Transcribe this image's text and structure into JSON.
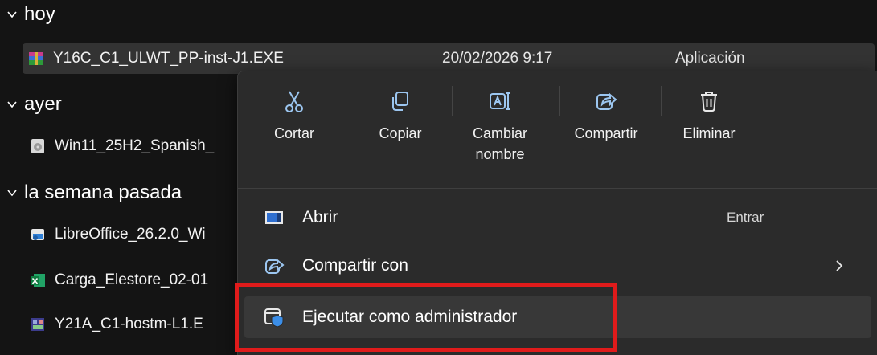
{
  "groups": [
    {
      "label": "hoy"
    },
    {
      "label": "ayer"
    },
    {
      "label": "la semana pasada"
    }
  ],
  "files": [
    {
      "name": "Y16C_C1_ULWT_PP-inst-J1.EXE",
      "date": "20/02/2026 9:17",
      "type": "Aplicación",
      "icon": "winrar-exe-icon"
    },
    {
      "name": "Win11_25H2_Spanish_",
      "icon": "disc-image-icon"
    },
    {
      "name": "LibreOffice_26.2.0_Wi",
      "icon": "installer-package-icon"
    },
    {
      "name": "Carga_Elestore_02-01",
      "icon": "excel-file-icon"
    },
    {
      "name": "Y21A_C1-hostm-L1.E",
      "icon": "app-exe-icon"
    }
  ],
  "context_menu": {
    "quick_actions": [
      {
        "label": "Cortar",
        "icon": "scissors-icon"
      },
      {
        "label": "Copiar",
        "icon": "copy-icon"
      },
      {
        "label": "Cambiar nombre",
        "icon": "rename-icon"
      },
      {
        "label": "Compartir",
        "icon": "share-icon"
      },
      {
        "label": "Eliminar",
        "icon": "trash-icon"
      }
    ],
    "items": [
      {
        "label": "Abrir",
        "shortcut": "Entrar",
        "icon": "open-app-icon"
      },
      {
        "label": "Compartir con",
        "icon": "share-icon",
        "submenu_icon": "chevron-right-icon"
      },
      {
        "label": "Ejecutar como administrador",
        "icon": "shield-admin-icon"
      }
    ]
  },
  "colors": {
    "background": "#141414",
    "menu_background": "#2b2b2b",
    "selected_row": "#333333",
    "highlight_border": "#e01b1b"
  }
}
